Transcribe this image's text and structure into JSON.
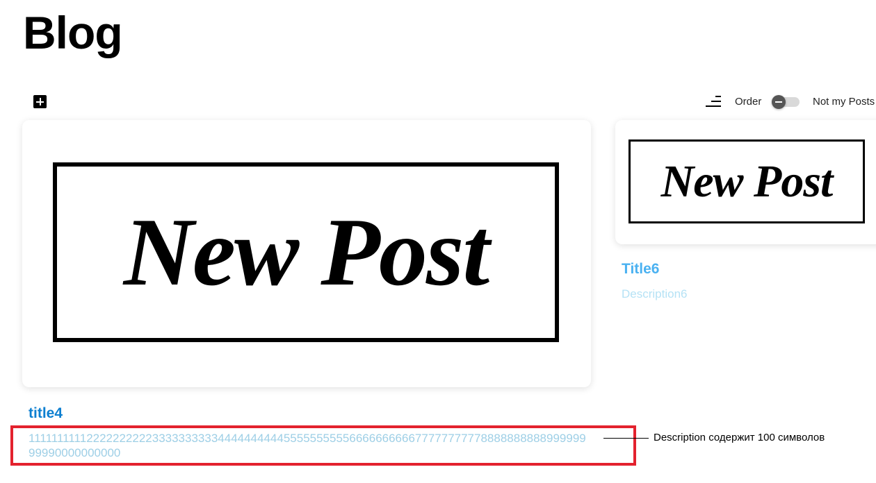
{
  "page": {
    "title": "Blog"
  },
  "toolbar": {
    "add_icon": "plus-square-icon",
    "sort_icon": "sort-lines-icon",
    "order_label": "Order",
    "not_my_posts_label": "Not my Posts",
    "not_my_posts_enabled": false
  },
  "posts": [
    {
      "image_text": "New Post",
      "title": "title4",
      "description": "1111111111222222222233333333334444444444555555555566666666667777777777888888888899999999990000000000"
    },
    {
      "image_text": "New Post",
      "title": "Title6",
      "description": "Description6"
    }
  ],
  "annotation": {
    "text": "Description содержит 100 символов"
  },
  "colors": {
    "title_primary": "#0d7fd0",
    "title_secondary": "#4ab1f1",
    "description": "#9ecfe6",
    "highlight_border": "#e3222e"
  }
}
